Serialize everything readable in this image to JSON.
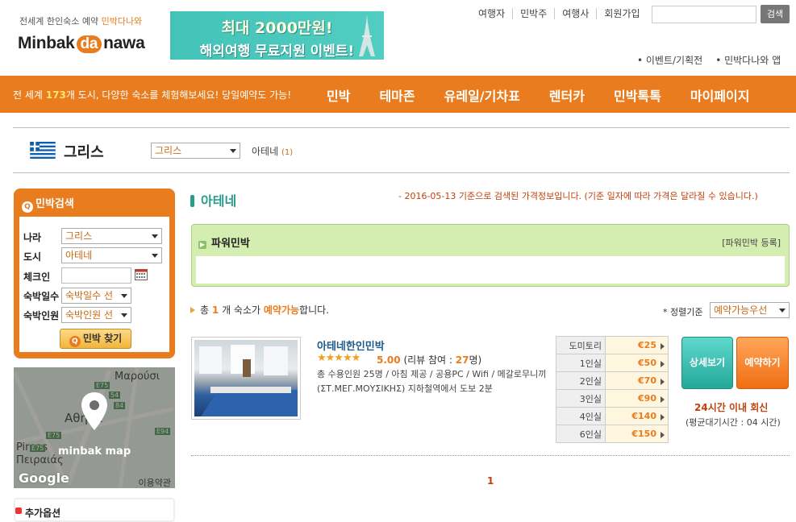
{
  "header": {
    "tagline_prefix": "전세계 한인숙소 예약",
    "tagline_brand": "민박다나와",
    "logo_left": "Minbak",
    "logo_mid": "da",
    "logo_right": "nawa",
    "banner_line1": "최대 2000만원!",
    "banner_line2": "해외여행 무료지원 이벤트!",
    "top_links": [
      "여행자",
      "민박주",
      "여행사",
      "회원가입"
    ],
    "search_button": "검색",
    "sub_links": [
      "• 이벤트/기획전",
      "• 민박다나와 앱"
    ]
  },
  "nav": {
    "tagline_pre": "전 세계",
    "city_count": "173",
    "tagline_post": "개 도시, 다양한 숙소를 체험해보세요! 당일예약도 가능!",
    "menu": [
      "민박",
      "테마존",
      "유레일/기차표",
      "렌터카",
      "민박톡톡",
      "마이페이지"
    ]
  },
  "country": {
    "title": "그리스",
    "select_value": "그리스",
    "city_name": "아테네",
    "city_count": "(1)"
  },
  "sidebar": {
    "title": "민박검색",
    "fields": [
      {
        "label": "나라",
        "value": "그리스"
      },
      {
        "label": "도시",
        "value": "아테네"
      },
      {
        "label": "체크인",
        "value": ""
      },
      {
        "label": "숙박일수",
        "value": "숙박일수 선"
      },
      {
        "label": "숙박인원",
        "value": "숙박인원 선"
      }
    ],
    "find_button": "민박 찾기",
    "map_label": "minbak map",
    "map_places": [
      "Μαρούσι",
      "Αθήνα",
      "Pireas",
      "Πειραιάς"
    ],
    "map_roads": [
      "E75",
      "54",
      "84",
      "E75",
      "E75",
      "E94"
    ],
    "google": "Google",
    "map_terms": "이용약관",
    "extra_title": "추가옵션"
  },
  "main": {
    "city_heading": "아테네",
    "notice": "- 2016-05-13 기준으로 검색된 가격정보입니다. (기준 일자에 따라 가격은 달라질 수 있습니다.)",
    "power_title": "파워민박",
    "power_register": "[파워민박 등록]",
    "total_pre": "총",
    "total_count": "1",
    "total_mid": "개 숙소가",
    "total_bold": "예약가능",
    "total_post": "합니다.",
    "sort_label": "* 정렬기준",
    "sort_value": "예약가능우선",
    "page": "1"
  },
  "listing": {
    "name": "아테네한인민박",
    "stars": "★★★★★",
    "score": "5.00",
    "review_pre": "(리뷰 참여 :",
    "review_count": "27",
    "review_post": "명)",
    "desc": "총 수용인원 25명 / 아침 제공 / 공용PC / Wifi / 메갈로무니끼(ΣΤ.ΜΕΓ.ΜΟΥΣΙΚΗΣ) 지하철역에서 도보 2분",
    "prices": [
      {
        "room": "도미토리",
        "price": "€25"
      },
      {
        "room": "1인실",
        "price": "€50"
      },
      {
        "room": "2인실",
        "price": "€70"
      },
      {
        "room": "3인실",
        "price": "€90"
      },
      {
        "room": "4인실",
        "price": "€140"
      },
      {
        "room": "6인실",
        "price": "€150"
      }
    ],
    "detail_button": "상세보기",
    "book_button": "예약하기",
    "reply": "24시간 이내 회신",
    "wait": "(평균대기시간 : 04 시간)"
  }
}
